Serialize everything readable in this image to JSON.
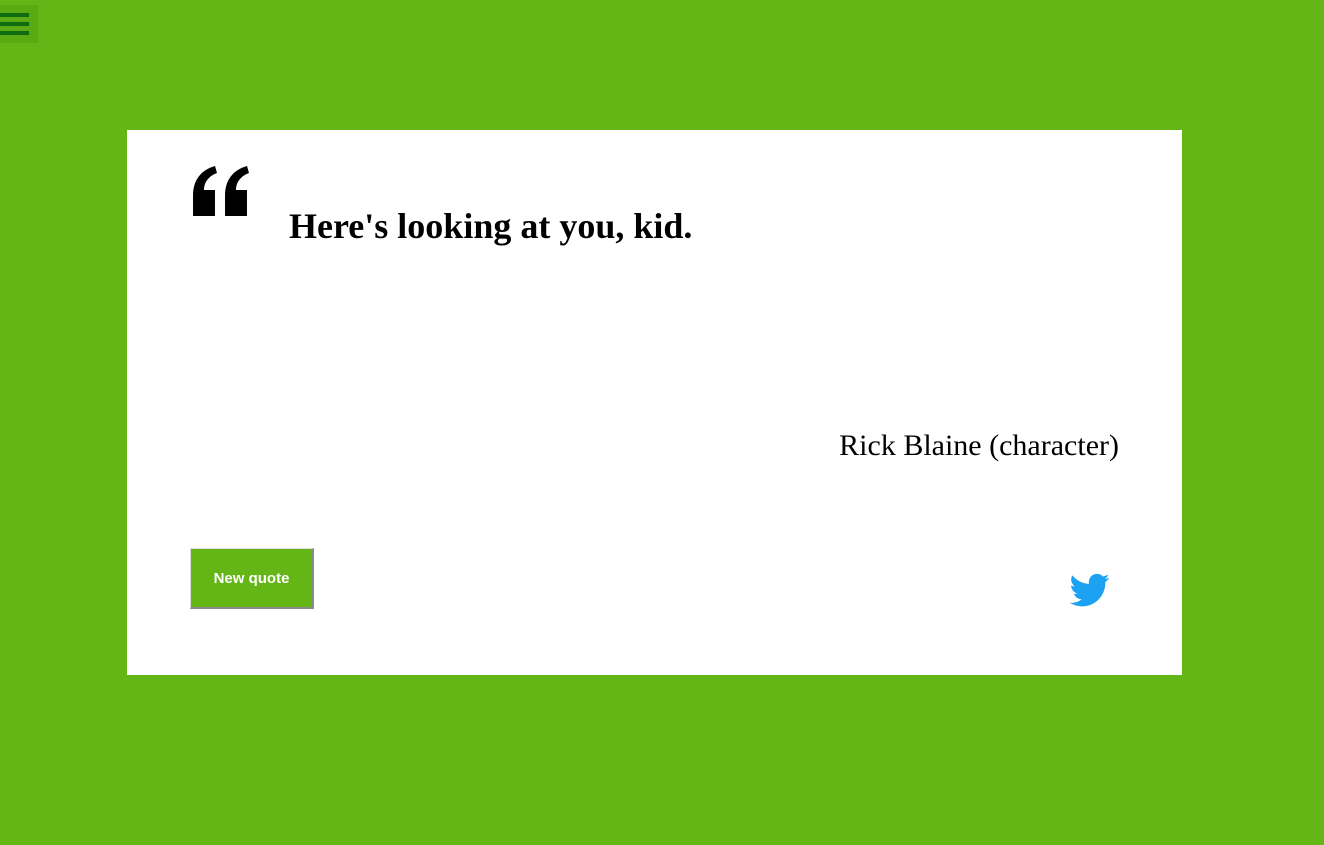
{
  "menu": {
    "icon": "hamburger-menu-icon"
  },
  "quote": {
    "mark_icon": "opening-quote-icon",
    "text": "Here's looking at you, kid.",
    "author": "Rick Blaine (character)"
  },
  "actions": {
    "new_quote_label": "New quote",
    "tweet_icon": "twitter-bird-icon"
  },
  "colors": {
    "background": "#64b516",
    "card": "#ffffff",
    "menu_bars": "#0e6b10",
    "button": "#64b516",
    "twitter": "#1da1f2"
  }
}
